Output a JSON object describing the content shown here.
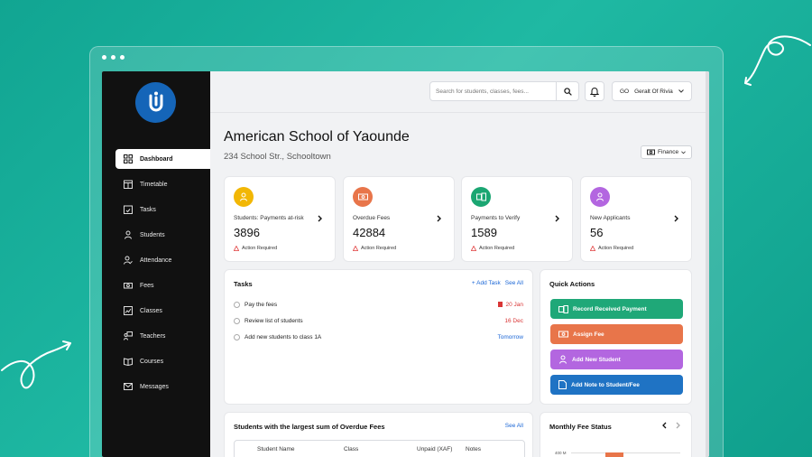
{
  "colors": {
    "background": "#13a892",
    "sidebar": "#111111",
    "logo": "#1565b8",
    "accent_link": "#1a66d6",
    "warning": "#e03a3a",
    "stat_icons": [
      "#f2b705",
      "#e8754a",
      "#1ba672",
      "#b366e0"
    ],
    "quick_actions": [
      "#1fa878",
      "#e8754a",
      "#b366e0",
      "#1f73c4"
    ]
  },
  "sidebar": {
    "items": [
      {
        "label": "Dashboard",
        "icon": "dashboard-icon",
        "active": true
      },
      {
        "label": "Timetable",
        "icon": "calendar-grid-icon",
        "active": false
      },
      {
        "label": "Tasks",
        "icon": "calendar-check-icon",
        "active": false
      },
      {
        "label": "Students",
        "icon": "student-icon",
        "active": false
      },
      {
        "label": "Attendance",
        "icon": "user-check-icon",
        "active": false
      },
      {
        "label": "Fees",
        "icon": "money-icon",
        "active": false
      },
      {
        "label": "Classes",
        "icon": "chart-board-icon",
        "active": false
      },
      {
        "label": "Teachers",
        "icon": "teacher-icon",
        "active": false
      },
      {
        "label": "Courses",
        "icon": "book-icon",
        "active": false
      },
      {
        "label": "Messages",
        "icon": "mail-icon",
        "active": false
      }
    ]
  },
  "header": {
    "search_placeholder": "Search for students, classes, fees...",
    "user_initials": "GO",
    "user_name": "Geralt Of Rivia"
  },
  "school": {
    "name": "American School of Yaounde",
    "address": "234 School Str., Schooltown",
    "view_selector": "Finance"
  },
  "stats": [
    {
      "label": "Students: Payments at-risk",
      "value": "3896",
      "status": "Action Required",
      "icon": "student-icon"
    },
    {
      "label": "Overdue Fees",
      "value": "42884",
      "status": "Action Required",
      "icon": "money-icon"
    },
    {
      "label": "Payments to Verify",
      "value": "1589",
      "status": "Action Required",
      "icon": "payment-verify-icon"
    },
    {
      "label": "New Applicants",
      "value": "56",
      "status": "Action Required",
      "icon": "applicant-icon"
    }
  ],
  "tasks": {
    "title": "Tasks",
    "add_label": "+  Add Task",
    "see_all": "See All",
    "items": [
      {
        "text": "Pay the fees",
        "due": "20 Jan",
        "due_color": "#d93535",
        "flag": true
      },
      {
        "text": "Review list of students",
        "due": "16 Dec",
        "due_color": "#d93535",
        "flag": false
      },
      {
        "text": "Add new students to class 1A",
        "due": "Tomorrow",
        "due_color": "#1a66d6",
        "flag": false
      }
    ]
  },
  "quick_actions": {
    "title": "Quick Actions",
    "buttons": [
      {
        "label": "Record Received Payment",
        "icon": "payment-icon"
      },
      {
        "label": "Assign Fee",
        "icon": "money-icon"
      },
      {
        "label": "Add New Student",
        "icon": "student-icon"
      },
      {
        "label": "Add Note to Student/Fee",
        "icon": "note-icon"
      }
    ]
  },
  "overdue": {
    "title": "Students with the largest sum of Overdue Fees",
    "see_all": "See All",
    "columns": [
      "Student Name",
      "Class",
      "Unpaid (XAF)",
      "Notes"
    ]
  },
  "monthly": {
    "title": "Monthly Fee Status",
    "axis_label": "400 M"
  }
}
